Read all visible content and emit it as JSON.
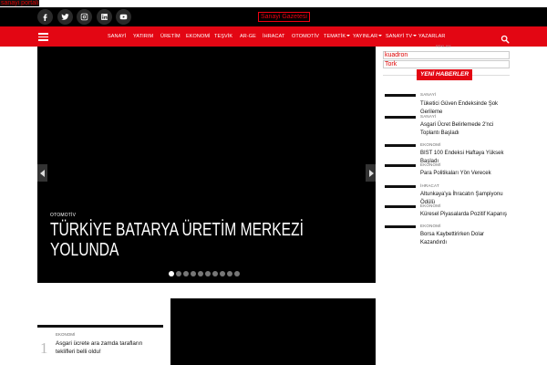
{
  "top_strip": {
    "portal_link": "sanayi portali"
  },
  "header": {
    "social_icons": [
      "facebook-icon",
      "twitter-icon",
      "instagram-icon",
      "linkedin-icon",
      "youtube-icon"
    ],
    "paper_link": "Sanayi Gazetesi"
  },
  "nav": {
    "items": [
      "SANAYİ",
      "YATIRIM",
      "ÜRETİM",
      "EKONOMİ",
      "TEŞVİK",
      "AR-GE",
      "İHRACAT",
      "OTOMOTİV",
      "TEMATİK",
      "YAYINLAR",
      "SANAYİ TV",
      "YAZARLAR"
    ]
  },
  "slider": {
    "category": "OTOMOTİV",
    "title": "TÜRKİYE BATARYA ÜRETİM MERKEZİ YOLUNDA",
    "slide_count": 10,
    "active_index": 0
  },
  "sidebar": {
    "ad_label": "REKLAM",
    "ad_links": [
      "kuadron",
      "Tork"
    ],
    "news_heading": "YENİ HABERLER",
    "news": [
      {
        "category": "SANAYİ",
        "title": "Tüketici Güven Endeksinde Şok Gerileme"
      },
      {
        "category": "SANAYİ",
        "title": "Asgari Ücret Belirlemede 2'nci Toplantı Başladı"
      },
      {
        "category": "EKONOMİ",
        "title": "BIST 100 Endeksi Haftaya Yüksek Başladı"
      },
      {
        "category": "EKONOMİ",
        "title": "Para Politikaları Yön Verecek"
      },
      {
        "category": "İHRACAT",
        "title": "Altunkaya'ya İhracatın Şampiyonu Ödülü"
      },
      {
        "category": "EKONOMİ",
        "title": "Küresel Piyasalarda Pozitif Kapanış"
      },
      {
        "category": "EKONOMİ",
        "title": "Borsa Kaybettirirken Dolar Kazandırdı"
      }
    ]
  },
  "bottom": {
    "number": "1",
    "category": "EKONOMİ",
    "title": "Asgari ücrete ara zamda tarafların teklifleri belli oldu!"
  }
}
